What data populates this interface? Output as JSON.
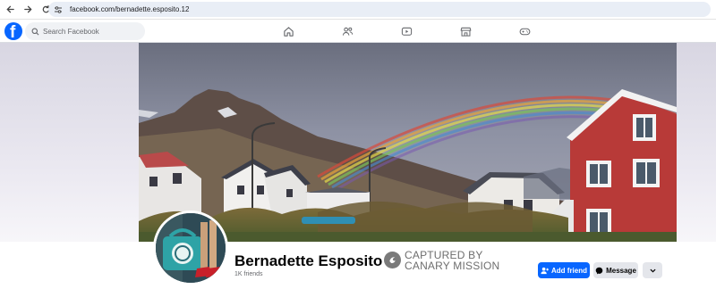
{
  "browser": {
    "url": "facebook.com/bernadette.esposito.12"
  },
  "fb_nav": {
    "search_placeholder": "Search Facebook",
    "tabs": [
      "home-icon",
      "friends-icon",
      "video-icon",
      "marketplace-icon",
      "gaming-icon"
    ]
  },
  "profile": {
    "name": "Bernadette Esposito",
    "friends": "1K friends"
  },
  "watermark": {
    "line1": "CAPTURED BY",
    "line2": "CANARY MISSION"
  },
  "actions": {
    "add_friend": "Add friend",
    "message": "Message"
  },
  "colors": {
    "brand": "#0866ff",
    "secondary_button": "#e4e6eb"
  }
}
